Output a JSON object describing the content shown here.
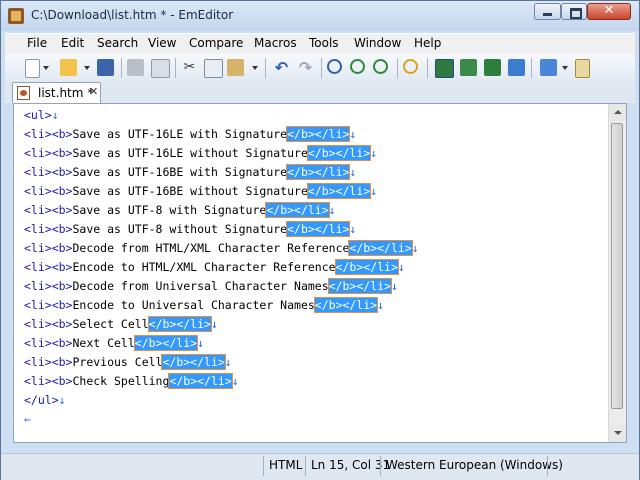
{
  "window": {
    "title": "C:\\Download\\list.htm * - EmEditor"
  },
  "menu": [
    "File",
    "Edit",
    "Search",
    "View",
    "Compare",
    "Macros",
    "Tools",
    "Window",
    "Help"
  ],
  "tab": {
    "label": "list.htm *"
  },
  "editor": {
    "open_tag": "<ul>",
    "close_tag": "</ul>",
    "line_prefix": "<li><b>",
    "line_suffix": "</b></li>",
    "items": [
      "Save as UTF-16LE with Signature",
      "Save as UTF-16LE without Signature",
      "Save as UTF-16BE with Signature",
      "Save as UTF-16BE without Signature",
      "Save as UTF-8 with Signature",
      "Save as UTF-8 without Signature",
      "Decode from HTML/XML Character Reference",
      "Encode to HTML/XML Character Reference",
      "Decode from Universal Character Names",
      "Encode to Universal Character Names",
      "Select Cell",
      "Next Cell",
      "Previous Cell",
      "Check Spelling"
    ],
    "newline_mark": "↓",
    "eof_mark": "←"
  },
  "status": {
    "syntax": "HTML",
    "position": "Ln 15, Col 31",
    "encoding": "Western European (Windows)"
  },
  "colors": {
    "selection": "#3399ff",
    "tag": "#1a1ab0",
    "newline": "#2a6be0"
  }
}
